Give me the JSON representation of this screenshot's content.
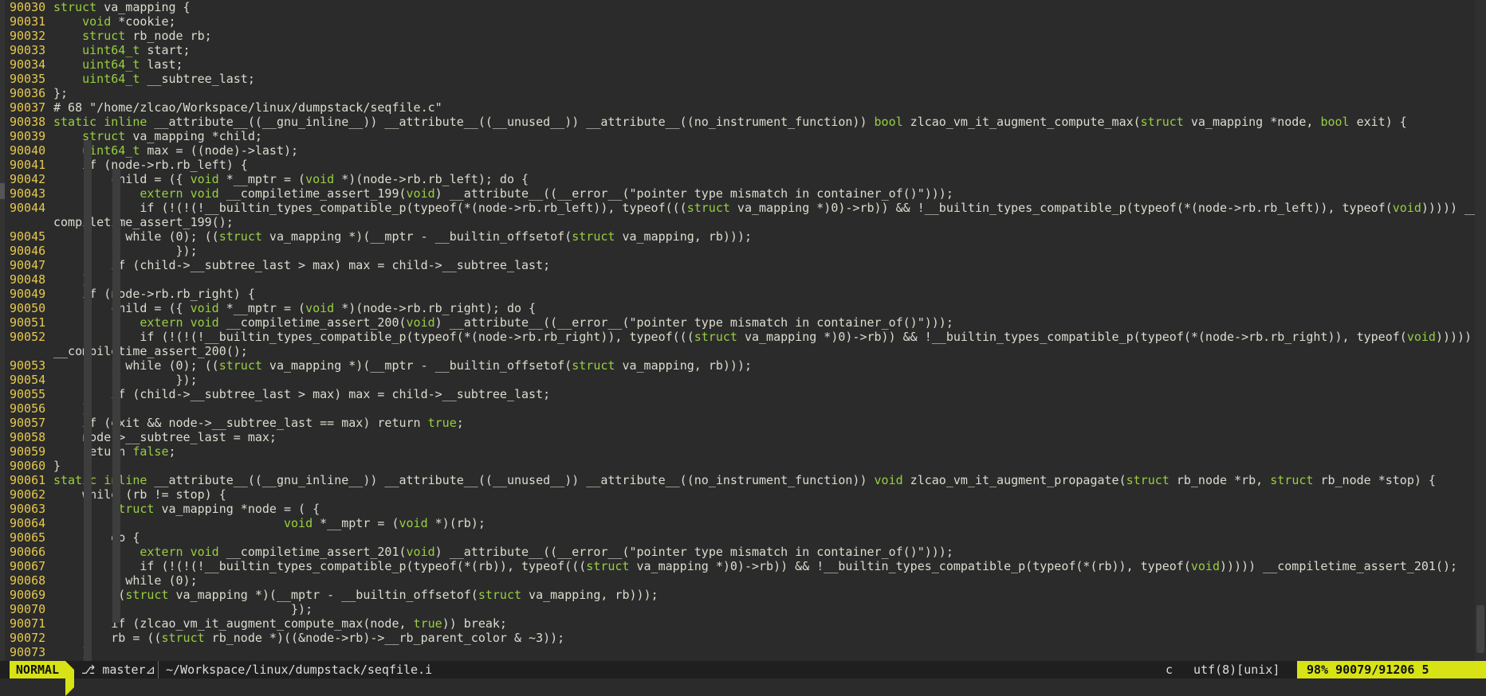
{
  "editor": {
    "lines": [
      {
        "n": "90030",
        "c": "struct va_mapping {"
      },
      {
        "n": "90031",
        "c": "    void *cookie;"
      },
      {
        "n": "90032",
        "c": "    struct rb_node rb;"
      },
      {
        "n": "90033",
        "c": "    uint64_t start;"
      },
      {
        "n": "90034",
        "c": "    uint64_t last;"
      },
      {
        "n": "90035",
        "c": "    uint64_t __subtree_last;"
      },
      {
        "n": "90036",
        "c": "};"
      },
      {
        "n": "90037",
        "c": "# 68 \"/home/zlcao/Workspace/linux/dumpstack/seqfile.c\""
      },
      {
        "n": "90038",
        "c": "static inline __attribute__((__gnu_inline__)) __attribute__((__unused__)) __attribute__((no_instrument_function)) bool zlcao_vm_it_augment_compute_max(struct va_mapping *node, bool exit) {"
      },
      {
        "n": "90039",
        "c": "    struct va_mapping *child;"
      },
      {
        "n": "90040",
        "c": "    uint64_t max = ((node)->last);"
      },
      {
        "n": "90041",
        "c": "    if (node->rb.rb_left) {"
      },
      {
        "n": "90042",
        "c": "        child = ({ void *__mptr = (void *)(node->rb.rb_left); do {"
      },
      {
        "n": "90043",
        "c": "            extern void __compiletime_assert_199(void) __attribute__((__error__(\"pointer type mismatch in container_of()\")));"
      },
      {
        "n": "90044",
        "c": "            if (!(!(!__builtin_types_compatible_p(typeof(*(node->rb.rb_left)), typeof(((struct va_mapping *)0)->rb)) && !__builtin_types_compatible_p(typeof(*(node->rb.rb_left)), typeof(void))))) __"
      },
      {
        "n": "",
        "c": "compiletime_assert_199();"
      },
      {
        "n": "90045",
        "c": "        } while (0); ((struct va_mapping *)(__mptr - __builtin_offsetof(struct va_mapping, rb)));"
      },
      {
        "n": "90046",
        "c": "                 });"
      },
      {
        "n": "90047",
        "c": "        if (child->__subtree_last > max) max = child->__subtree_last;"
      },
      {
        "n": "90048",
        "c": "    }"
      },
      {
        "n": "90049",
        "c": "    if (node->rb.rb_right) {"
      },
      {
        "n": "90050",
        "c": "        child = ({ void *__mptr = (void *)(node->rb.rb_right); do {"
      },
      {
        "n": "90051",
        "c": "            extern void __compiletime_assert_200(void) __attribute__((__error__(\"pointer type mismatch in container_of()\")));"
      },
      {
        "n": "90052",
        "c": "            if (!(!(!__builtin_types_compatible_p(typeof(*(node->rb.rb_right)), typeof(((struct va_mapping *)0)->rb)) && !__builtin_types_compatible_p(typeof(*(node->rb.rb_right)), typeof(void)))))"
      },
      {
        "n": "",
        "c": "__compiletime_assert_200();"
      },
      {
        "n": "90053",
        "c": "        } while (0); ((struct va_mapping *)(__mptr - __builtin_offsetof(struct va_mapping, rb)));"
      },
      {
        "n": "90054",
        "c": "                 });"
      },
      {
        "n": "90055",
        "c": "        if (child->__subtree_last > max) max = child->__subtree_last;"
      },
      {
        "n": "90056",
        "c": "    }"
      },
      {
        "n": "90057",
        "c": "    if (exit && node->__subtree_last == max) return true;"
      },
      {
        "n": "90058",
        "c": "    node->__subtree_last = max;"
      },
      {
        "n": "90059",
        "c": "    return false;"
      },
      {
        "n": "90060",
        "c": "}"
      },
      {
        "n": "90061",
        "c": "static inline __attribute__((__gnu_inline__)) __attribute__((__unused__)) __attribute__((no_instrument_function)) void zlcao_vm_it_augment_propagate(struct rb_node *rb, struct rb_node *stop) {"
      },
      {
        "n": "90062",
        "c": "    while (rb != stop) {"
      },
      {
        "n": "90063",
        "c": "        struct va_mapping *node = ( {"
      },
      {
        "n": "90064",
        "c": "                                void *__mptr = (void *)(rb);"
      },
      {
        "n": "90065",
        "c": "        do {"
      },
      {
        "n": "90066",
        "c": "            extern void __compiletime_assert_201(void) __attribute__((__error__(\"pointer type mismatch in container_of()\")));"
      },
      {
        "n": "90067",
        "c": "            if (!(!(!__builtin_types_compatible_p(typeof(*(rb)), typeof(((struct va_mapping *)0)->rb)) && !__builtin_types_compatible_p(typeof(*(rb)), typeof(void))))) __compiletime_assert_201();"
      },
      {
        "n": "90068",
        "c": "        } while (0);"
      },
      {
        "n": "90069",
        "c": "        ((struct va_mapping *)(__mptr - __builtin_offsetof(struct va_mapping, rb)));"
      },
      {
        "n": "90070",
        "c": "                                 });"
      },
      {
        "n": "90071",
        "c": "        if (zlcao_vm_it_augment_compute_max(node, true)) break;"
      },
      {
        "n": "90072",
        "c": "        rb = ((struct rb_node *)((&node->rb)->__rb_parent_color & ~3));"
      },
      {
        "n": "90073",
        "c": "    }"
      }
    ]
  },
  "statusline": {
    "mode": "NORMAL",
    "branch": "⎇ master",
    "branch_flag": "⊿",
    "filepath": "~/Workspace/linux/dumpstack/seqfile.i",
    "filetype": "c",
    "encoding": "utf(8)[unix]",
    "percent": "98%",
    "position": "90079/91206",
    "column": "5"
  },
  "colors": {
    "background": "#2b2b2b",
    "line_number": "#e6c84c",
    "keyword": "#98cf3f",
    "text": "#dcdcd0",
    "bracket_red": "#e21b2c",
    "bracket_cyan": "#1fa3a3",
    "mode_bg": "#d7e314"
  }
}
